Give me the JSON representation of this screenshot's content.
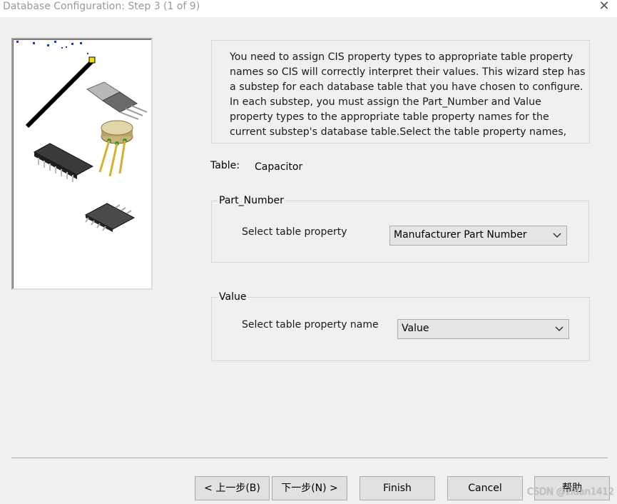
{
  "window": {
    "title": "Database Configuration: Step 3 (1 of 9)",
    "close_icon": "close-icon"
  },
  "description": "You need to assign CIS property types to appropriate table property names so CIS will correctly interpret their values. This wizard step has a substep for each database table that you have chosen to configure. In each substep, you must assign the Part_Number and Value property types to the appropriate table property names for the current substep's database table.Select the table property names,",
  "table": {
    "label": "Table:",
    "value": "Capacitor"
  },
  "part_number_group": {
    "legend": "Part_Number",
    "select_label": "Select table property",
    "selected": "Manufacturer Part Number"
  },
  "value_group": {
    "legend": "Value",
    "select_label": "Select table property name",
    "selected": "Value"
  },
  "buttons": {
    "back": "< 上一步(B)",
    "next": "下一步(N) >",
    "finish": "Finish",
    "cancel": "Cancel",
    "help": "帮助"
  },
  "watermark": "CSDN @zidan1412"
}
